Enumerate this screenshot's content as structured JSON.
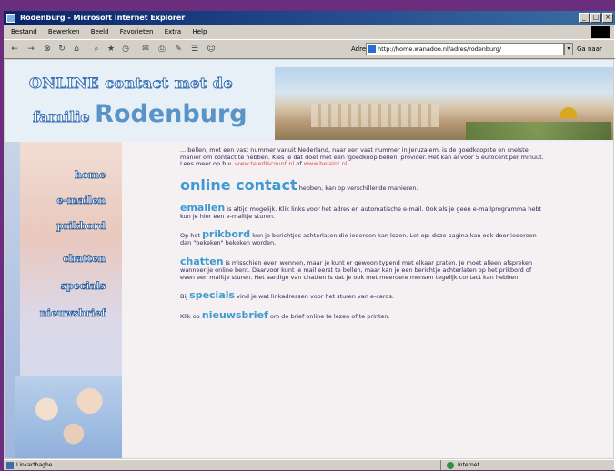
{
  "window": {
    "title": "Rodenburg - Microsoft Internet Explorer",
    "menu": [
      "Bestand",
      "Bewerken",
      "Beeld",
      "Favorieten",
      "Extra",
      "Help"
    ],
    "address_label": "Adres",
    "url": "http://home.wanadoo.nl/adres/rodenburg/",
    "go_label": "Ga naar"
  },
  "header": {
    "title_line1": "ONLINE contact met de",
    "title_prefix": "familie",
    "title_name": "Rodenburg"
  },
  "nav": {
    "items": [
      "home",
      "e-mailen",
      "prikbord",
      "chatten",
      "specials",
      "nieuwsbrief"
    ]
  },
  "content": {
    "intro": "... bellen, met een vast nummer vanuit Nederland, naar een vast nummer in Jeruzalem, is de goedkoopste en snelste manier om contact te hebben. Kies je dat doet met een 'goedkoop bellen' provider. Het kan al voor 5 eurocent per minuut. Lees meer op b.v.",
    "intro_link1": "www.telediscount.nl",
    "intro_of": "of",
    "intro_link2": "www.belaint.nl",
    "online_heading": "online contact",
    "online_text": "hebben, kan op verschillende manieren.",
    "emailen_heading": "emailen",
    "emailen_text": "is altijd mogelijk. Klik links voor het adres en automatische e-mail. Ook als je geen e-mailprogramma hebt kun je hier een e-mailtje sturen.",
    "prikbord_pre": "Op het",
    "prikbord_heading": "prikbord",
    "prikbord_text": "kun je berichtjes achterlaten die iedereen kan lezen. Let op: deze pagina kan ook door iedereen dan \"bekeken\" bekeken worden.",
    "chatten_heading": "chatten",
    "chatten_text": "is misschien even wennen, maar je kunt er gewoon typend met elkaar praten. Je moet alleen afspreken wanneer je online bent. Daarvoor kunt je mail eerst te bellen, maar kan je een berichtje achterlaten op het prikbord of even een mailtje sturen. Het aardige van chatten is dat je ook met meerdere mensen tegelijk contact kan hebben.",
    "specials_pre": "Bij",
    "specials_heading": "specials",
    "specials_text": "vind je wat linkadressen voor het sturen van e-cards.",
    "nieuwsbrief_pre": "Klik op",
    "nieuwsbrief_heading": "nieuwsbrief",
    "nieuwsbrief_text": "om de brief online te lezen of te printen."
  },
  "status": {
    "left": "Linkartbaghe",
    "zone": "Internet"
  },
  "colors": {
    "heading_blue": "#3e9ad2",
    "link_red": "#e0505a",
    "background_purple": "#6b2d7e"
  }
}
